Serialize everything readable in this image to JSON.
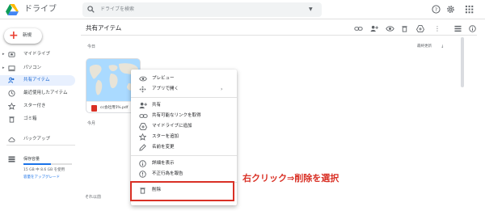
{
  "header": {
    "app_title": "ドライブ",
    "search_placeholder": "ドライブを検索"
  },
  "sidebar": {
    "new_label": "新規",
    "items": [
      {
        "label": "マイドライブ",
        "icon": "drive-folder-icon",
        "caret": "▸",
        "active": false
      },
      {
        "label": "パソコン",
        "icon": "computer-icon",
        "caret": "▸",
        "active": false
      },
      {
        "label": "共有アイテム",
        "icon": "shared-people-icon",
        "caret": "",
        "active": true
      },
      {
        "label": "最近使用したアイテム",
        "icon": "clock-icon",
        "caret": "",
        "active": false
      },
      {
        "label": "スター付き",
        "icon": "star-icon",
        "caret": "",
        "active": false
      },
      {
        "label": "ゴミ箱",
        "icon": "trash-icon",
        "caret": "",
        "active": false
      },
      {
        "label": "バックアップ",
        "icon": "backup-cloud-icon",
        "caret": "",
        "active": false
      }
    ],
    "storage": {
      "label": "保存容量",
      "usage": "15 GB 中 8.6 GB を使用",
      "fraction": 0.57,
      "upgrade": "容量をアップグレード"
    }
  },
  "main": {
    "title": "共有アイテム",
    "sections": {
      "today": "今日",
      "earlier": "今月",
      "older": "それ以前"
    },
    "sort_label": "最終更新",
    "sort_icon": "arrow-down-icon",
    "file": {
      "name": "cc会社用5%.pdf",
      "type_icon": "pdf-icon"
    }
  },
  "context_menu": {
    "items": [
      {
        "label": "プレビュー",
        "icon": "eye-icon"
      },
      {
        "label": "アプリで開く",
        "icon": "open-with-icon",
        "submenu": "›"
      },
      {
        "label": "共有",
        "icon": "person-add-icon"
      },
      {
        "label": "共有可能なリンクを取得",
        "icon": "link-icon"
      },
      {
        "label": "マイドライブに追加",
        "icon": "add-to-drive-icon"
      },
      {
        "label": "スターを追加",
        "icon": "star-outline-icon"
      },
      {
        "label": "名前を変更",
        "icon": "pencil-icon"
      },
      {
        "label": "詳細を表示",
        "icon": "info-icon"
      },
      {
        "label": "不正行為を報告",
        "icon": "report-icon"
      },
      {
        "label": "削除",
        "icon": "trash-icon"
      }
    ]
  },
  "annotation": {
    "text": "右クリック⇒削除を選択",
    "color": "#d93025"
  },
  "colors": {
    "accent": "#1a73e8",
    "active_bg": "#e8f0fe",
    "highlight": "#d93025"
  }
}
